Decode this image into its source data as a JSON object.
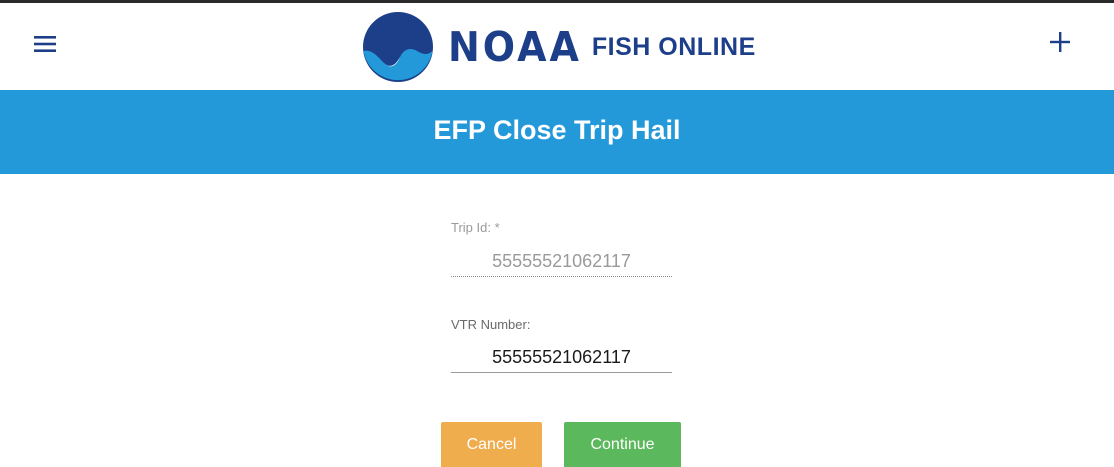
{
  "header": {
    "menu_icon": "hamburger-menu-icon",
    "brand_noaa": "NOAA",
    "brand_fish_online": "FISH ONLINE",
    "add_icon": "plus-icon"
  },
  "banner": {
    "title": "EFP Close Trip Hail"
  },
  "form": {
    "trip_id": {
      "label": "Trip Id: *",
      "value": "55555521062117"
    },
    "vtr_number": {
      "label": "VTR Number:",
      "value": "55555521062117"
    }
  },
  "actions": {
    "cancel_label": "Cancel",
    "continue_label": "Continue"
  },
  "colors": {
    "banner": "#2399d9",
    "brand": "#1d3f8a",
    "cancel": "#f0ad4e",
    "continue": "#5cb85c"
  }
}
